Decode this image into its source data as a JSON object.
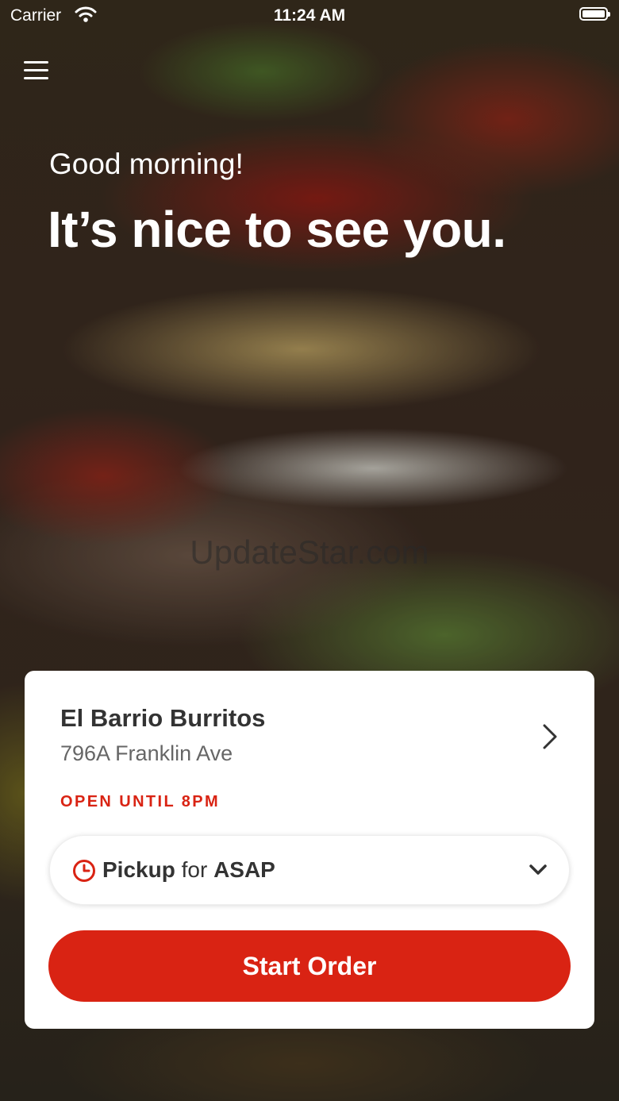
{
  "status_bar": {
    "carrier": "Carrier",
    "time": "11:24 AM"
  },
  "greeting": {
    "subtitle": "Good morning!",
    "headline": "It’s nice to see you."
  },
  "watermark": "UpdateStar.com",
  "store": {
    "name": "El Barrio Burritos",
    "address": "796A Franklin Ave",
    "hours": "OPEN UNTIL 8PM"
  },
  "order_mode": {
    "method": "Pickup",
    "connector": "for",
    "time": "ASAP"
  },
  "actions": {
    "start_order_label": "Start Order"
  },
  "colors": {
    "accent": "#d92313",
    "text_dark": "#333333",
    "text_muted": "#666666"
  },
  "icons": [
    "menu-icon",
    "wifi-icon",
    "battery-icon",
    "chevron-right-icon",
    "clock-icon",
    "chevron-down-icon"
  ]
}
